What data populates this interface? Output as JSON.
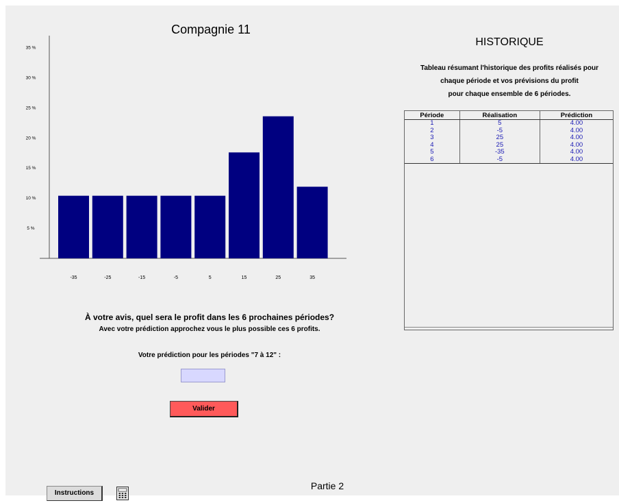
{
  "chart": {
    "title": "Compagnie 11"
  },
  "chart_data": {
    "type": "bar",
    "categories": [
      "-35",
      "-25",
      "-15",
      "-5",
      "5",
      "15",
      "25",
      "35"
    ],
    "values": [
      10.4,
      10.4,
      10.4,
      10.4,
      10.4,
      17.6,
      23.6,
      11.9
    ],
    "ylim": [
      0,
      37
    ],
    "yticks": [
      5,
      10,
      15,
      20,
      25,
      30,
      35
    ],
    "ytick_labels": [
      "5 %",
      "10 %",
      "15 %",
      "20 %",
      "25 %",
      "30 %",
      "35 %"
    ],
    "bar_color": "#000080",
    "grid": false
  },
  "question": {
    "main": "À votre avis, quel sera le profit dans les 6 prochaines périodes?",
    "sub": "Avec votre prédiction approchez vous le plus possible ces 6 profits.",
    "input_label": "Votre prédiction pour les périodes \"7 à 12\" :",
    "input_value": ""
  },
  "validate_label": "Valider",
  "history": {
    "title": "HISTORIQUE",
    "desc_line1": "Tableau résumant l'historique des profits réalisés pour",
    "desc_line2": "chaque période et vos prévisions du profit",
    "desc_line3": "pour chaque ensemble de 6 périodes.",
    "columns": [
      "Période",
      "Réalisation",
      "Prédiction"
    ],
    "rows": [
      [
        "1",
        "5",
        "4.00"
      ],
      [
        "2",
        "-5",
        "4.00"
      ],
      [
        "3",
        "25",
        "4.00"
      ],
      [
        "4",
        "25",
        "4.00"
      ],
      [
        "5",
        "-35",
        "4.00"
      ],
      [
        "6",
        "-5",
        "4.00"
      ]
    ]
  },
  "footer": {
    "instructions_label": "Instructions",
    "calculator_icon": "calculator-icon",
    "part_label": "Partie 2"
  },
  "colors": {
    "background": "#efefef",
    "bar": "#000080",
    "validate_button": "#ff5a5a",
    "input_background": "#d8d8ff",
    "table_values": "#1a1ab4"
  }
}
